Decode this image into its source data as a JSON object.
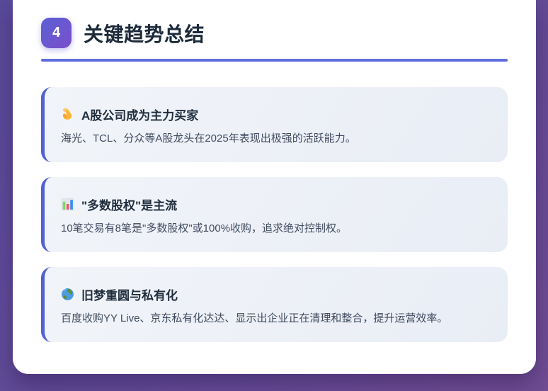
{
  "header": {
    "badge_number": "4",
    "title": "关键趋势总结"
  },
  "cards": [
    {
      "icon": "muscle-icon",
      "icon_char": "💪",
      "title": "A股公司成为主力买家",
      "body": "海光、TCL、分众等A股龙头在2025年表现出极强的活跃能力。"
    },
    {
      "icon": "bar-chart-icon",
      "icon_char": "📊",
      "title": "\"多数股权\"是主流",
      "body": "10笔交易有8笔是\"多数股权\"或100%收购，追求绝对控制权。"
    },
    {
      "icon": "globe-icon",
      "icon_char": "🌏",
      "title": "旧梦重圆与私有化",
      "body": "百度收购YY Live、京东私有化达达、显示出企业正在清理和整合，提升运营效率。"
    }
  ],
  "colors": {
    "frame_purple_start": "#594a9a",
    "frame_purple_end": "#714d93",
    "badge_gradient_start": "#5a60d6",
    "badge_gradient_end": "#7b4fc9",
    "divider": "#5f6edc",
    "card_border": "#5262d3",
    "card_background": "#edf0f7",
    "title_text": "#1c2a3a",
    "body_text": "#3f4b5f"
  }
}
